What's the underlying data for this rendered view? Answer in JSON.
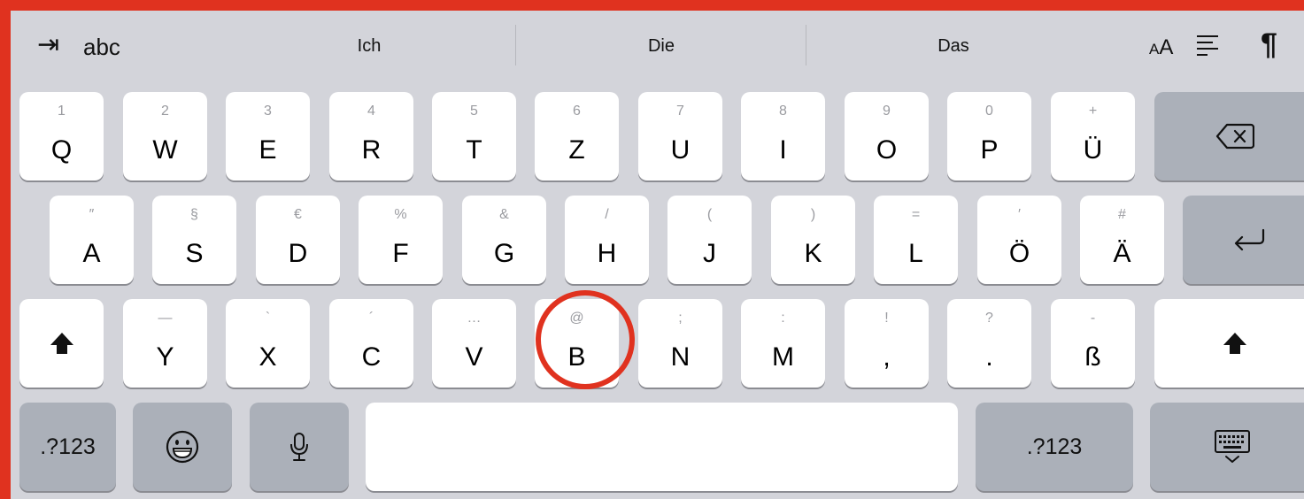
{
  "shortcut_bar": {
    "tab_icon": "tab-arrow-icon",
    "abc_label": "abc",
    "predictions": [
      "Ich",
      "Die",
      "Das"
    ],
    "text_size_icon": "text-size-icon",
    "text_size_label_small": "A",
    "text_size_label_large": "A",
    "align_icon": "align-left-icon",
    "pilcrow_label": "¶"
  },
  "row1": [
    {
      "main": "Q",
      "sec": "1"
    },
    {
      "main": "W",
      "sec": "2"
    },
    {
      "main": "E",
      "sec": "3"
    },
    {
      "main": "R",
      "sec": "4"
    },
    {
      "main": "T",
      "sec": "5"
    },
    {
      "main": "Z",
      "sec": "6"
    },
    {
      "main": "U",
      "sec": "7"
    },
    {
      "main": "I",
      "sec": "8"
    },
    {
      "main": "O",
      "sec": "9"
    },
    {
      "main": "P",
      "sec": "0"
    },
    {
      "main": "Ü",
      "sec": "+"
    }
  ],
  "row2": [
    {
      "main": "A",
      "sec": "″"
    },
    {
      "main": "S",
      "sec": "§"
    },
    {
      "main": "D",
      "sec": "€"
    },
    {
      "main": "F",
      "sec": "%"
    },
    {
      "main": "G",
      "sec": "&"
    },
    {
      "main": "H",
      "sec": "/"
    },
    {
      "main": "J",
      "sec": "("
    },
    {
      "main": "K",
      "sec": ")"
    },
    {
      "main": "L",
      "sec": "="
    },
    {
      "main": "Ö",
      "sec": "′"
    },
    {
      "main": "Ä",
      "sec": "#"
    }
  ],
  "row3": [
    {
      "main": "Y",
      "sec": "—"
    },
    {
      "main": "X",
      "sec": "`"
    },
    {
      "main": "C",
      "sec": "´"
    },
    {
      "main": "V",
      "sec": "…"
    },
    {
      "main": "B",
      "sec": "@"
    },
    {
      "main": "N",
      "sec": ";"
    },
    {
      "main": "M",
      "sec": ":"
    },
    {
      "main": ",",
      "sec": "!"
    },
    {
      "main": ".",
      "sec": "?"
    },
    {
      "main": "ß",
      "sec": "-"
    }
  ],
  "bottom_row": {
    "numbers_label_left": ".?123",
    "numbers_label_right": ".?123",
    "emoji_icon": "emoji-icon",
    "mic_icon": "microphone-icon",
    "hide_keyboard_icon": "hide-keyboard-icon"
  },
  "icons": {
    "delete": "delete-icon",
    "return": "return-icon",
    "shift": "shift-icon"
  },
  "annotation": {
    "color": "#e0321f",
    "highlighted_key": "B"
  },
  "colors": {
    "keyboard_bg": "#d3d4da",
    "key": "#ffffff",
    "function_key": "#abb0b9"
  }
}
